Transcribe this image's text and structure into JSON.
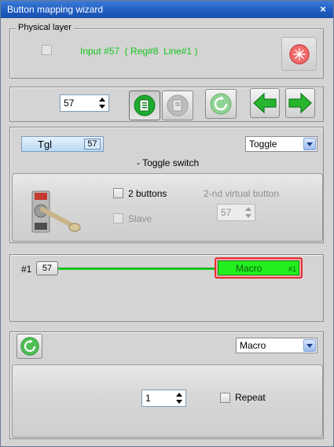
{
  "window": {
    "title": "Button mapping wizard",
    "close_glyph": "×"
  },
  "physical": {
    "group_label": "Physical layer",
    "input_text": "Input #57  ( Reg#8  Line#1 )",
    "accent": "#15c41a",
    "indicator_icon": "red-star-icon"
  },
  "toolbar": {
    "button_number": "57",
    "icons": [
      "sheet-green-icon",
      "sheet-gray-icon",
      "refresh-icon",
      "arrow-left-icon",
      "arrow-right-icon"
    ]
  },
  "mode": {
    "tag_label": "Tgl",
    "tag_number": "57",
    "type_select": "Toggle",
    "description": "- Toggle switch",
    "two_buttons_label": "2 buttons",
    "slave_label": "Slave",
    "second_virtual_label": "2-nd virtual button",
    "second_virtual_value": "57"
  },
  "mapping": {
    "index": "#1",
    "button": "57",
    "target_label": "Macro",
    "target_index": "#1",
    "link_color": "#1bd11f"
  },
  "action": {
    "type_select": "Macro",
    "count_value": "1",
    "repeat_label": "Repeat"
  }
}
